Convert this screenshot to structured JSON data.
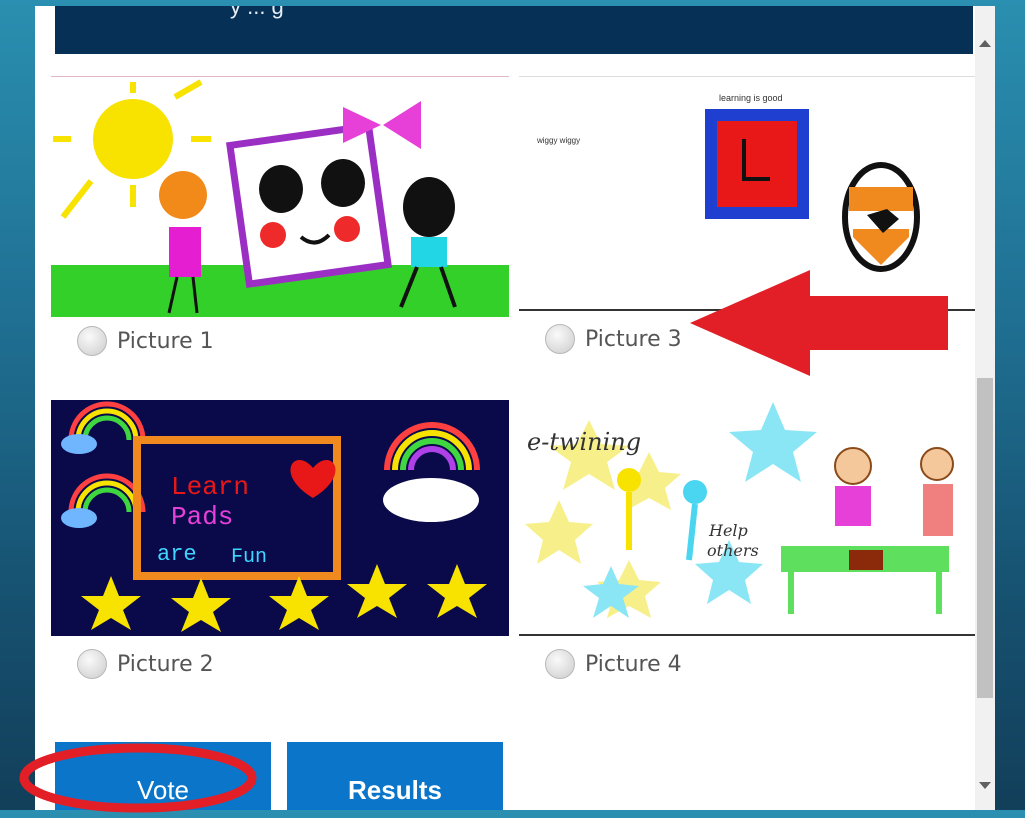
{
  "header": {
    "partial_title": "y ... g"
  },
  "options": [
    {
      "label": "Picture 1"
    },
    {
      "label": "Picture 3"
    },
    {
      "label": "Picture 2"
    },
    {
      "label": "Picture 4"
    }
  ],
  "drawings": {
    "pic3_caption": "learning is good",
    "pic3_note": "wiggy wiggy",
    "pic2_text": [
      "Learn",
      "Pads",
      "are",
      "Fun"
    ],
    "pic4_title": "e-twining",
    "pic4_note": [
      "Help",
      "others"
    ]
  },
  "buttons": {
    "vote": "Vote",
    "results": "Results"
  },
  "colors": {
    "header": "#063056",
    "button": "#0b75c9",
    "annotation": "#e21f26"
  }
}
